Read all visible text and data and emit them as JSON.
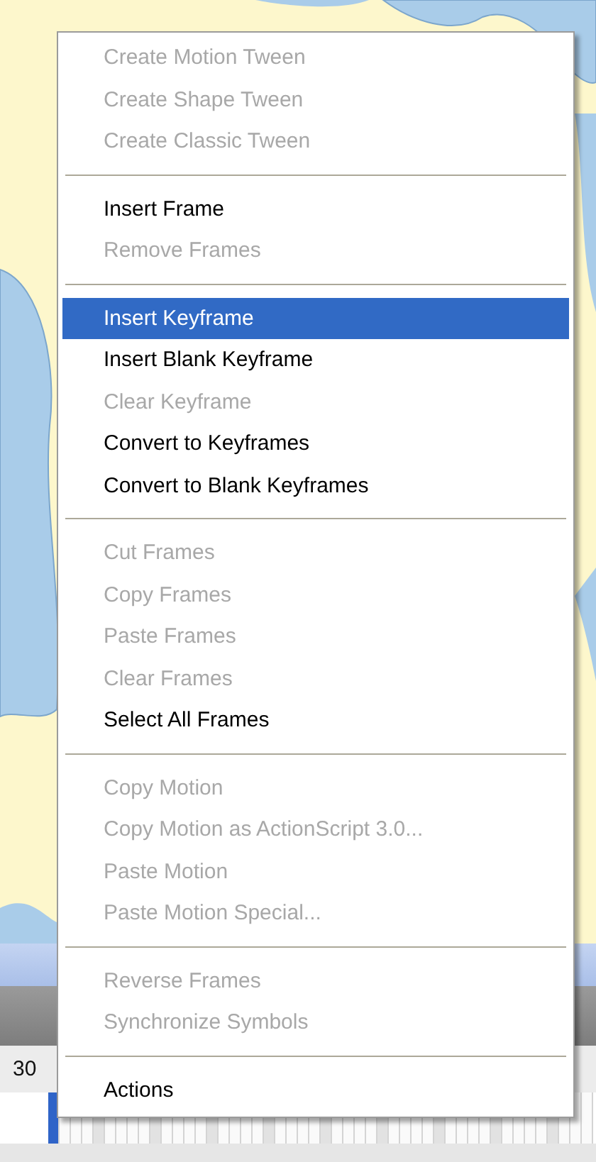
{
  "timeline": {
    "ruler_label": "30"
  },
  "context_menu": {
    "groups": [
      {
        "items": [
          {
            "label": "Create Motion Tween",
            "disabled": true,
            "selected": false
          },
          {
            "label": "Create Shape Tween",
            "disabled": true,
            "selected": false
          },
          {
            "label": "Create Classic Tween",
            "disabled": true,
            "selected": false
          }
        ]
      },
      {
        "items": [
          {
            "label": "Insert Frame",
            "disabled": false,
            "selected": false
          },
          {
            "label": "Remove Frames",
            "disabled": true,
            "selected": false
          }
        ]
      },
      {
        "items": [
          {
            "label": "Insert Keyframe",
            "disabled": false,
            "selected": true
          },
          {
            "label": "Insert Blank Keyframe",
            "disabled": false,
            "selected": false
          },
          {
            "label": "Clear Keyframe",
            "disabled": true,
            "selected": false
          },
          {
            "label": "Convert to Keyframes",
            "disabled": false,
            "selected": false
          },
          {
            "label": "Convert to Blank Keyframes",
            "disabled": false,
            "selected": false
          }
        ]
      },
      {
        "items": [
          {
            "label": "Cut Frames",
            "disabled": true,
            "selected": false
          },
          {
            "label": "Copy Frames",
            "disabled": true,
            "selected": false
          },
          {
            "label": "Paste Frames",
            "disabled": true,
            "selected": false
          },
          {
            "label": "Clear Frames",
            "disabled": true,
            "selected": false
          },
          {
            "label": "Select All Frames",
            "disabled": false,
            "selected": false
          }
        ]
      },
      {
        "items": [
          {
            "label": "Copy Motion",
            "disabled": true,
            "selected": false
          },
          {
            "label": "Copy Motion as ActionScript 3.0...",
            "disabled": true,
            "selected": false
          },
          {
            "label": "Paste Motion",
            "disabled": true,
            "selected": false
          },
          {
            "label": "Paste Motion Special...",
            "disabled": true,
            "selected": false
          }
        ]
      },
      {
        "items": [
          {
            "label": "Reverse Frames",
            "disabled": true,
            "selected": false
          },
          {
            "label": "Synchronize Symbols",
            "disabled": true,
            "selected": false
          }
        ]
      },
      {
        "items": [
          {
            "label": "Actions",
            "disabled": false,
            "selected": false
          }
        ]
      }
    ]
  }
}
